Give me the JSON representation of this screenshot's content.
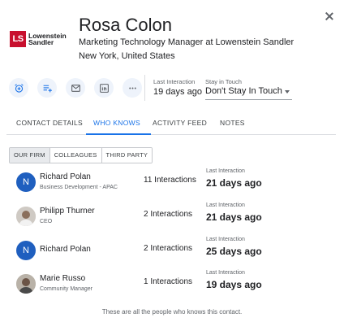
{
  "contact": {
    "name": "Rosa Colon",
    "title": "Marketing Technology Manager at Lowenstein Sandler",
    "location": "New York, United States"
  },
  "company_logo": {
    "mark": "LS",
    "line1": "Lowenstein",
    "line2": "Sandler",
    "brand_color": "#c8102e"
  },
  "actions": [
    {
      "icon": "alarm-clock-add-icon"
    },
    {
      "icon": "playlist-add-icon"
    },
    {
      "icon": "email-icon"
    },
    {
      "icon": "linkedin-icon"
    },
    {
      "icon": "more-horizontal-icon"
    }
  ],
  "last_interaction": {
    "label": "Last Interaction",
    "value": "19 days ago"
  },
  "stay_in_touch": {
    "label": "Stay in Touch",
    "value": "Don't Stay In Touch"
  },
  "tabs": [
    {
      "label": "CONTACT DETAILS",
      "active": false
    },
    {
      "label": "WHO KNOWS",
      "active": true
    },
    {
      "label": "ACTIVITY FEED",
      "active": false
    },
    {
      "label": "NOTES",
      "active": false
    }
  ],
  "filter": [
    {
      "label": "OUR FIRM",
      "active": true
    },
    {
      "label": "COLLEAGUES",
      "active": false
    },
    {
      "label": "THIRD PARTY",
      "active": false
    }
  ],
  "people": [
    {
      "name": "Richard Polan",
      "subtitle": "Business Development - APAC",
      "avatar": "N",
      "interactions": "11 Interactions",
      "last_label": "Last Interaction",
      "last_value": "21 days ago"
    },
    {
      "name": "Philipp Thurner",
      "subtitle": "CEO",
      "avatar": "",
      "interactions": "2 Interactions",
      "last_label": "Last Interaction",
      "last_value": "21 days ago"
    },
    {
      "name": "Richard Polan",
      "subtitle": "",
      "avatar": "N",
      "interactions": "2 Interactions",
      "last_label": "Last Interaction",
      "last_value": "25 days ago"
    },
    {
      "name": "Marie Russo",
      "subtitle": "Community Manager",
      "avatar": "",
      "interactions": "1 Interactions",
      "last_label": "Last Interaction",
      "last_value": "19 days ago"
    }
  ],
  "footer": "These are all the people who knows this contact.",
  "colors": {
    "accent": "#1a73e8",
    "avatar_blue": "#1f5fbf"
  }
}
